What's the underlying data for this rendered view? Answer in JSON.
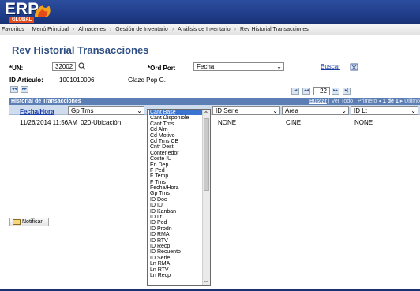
{
  "brand": {
    "logo_text": "ERP",
    "logo_sub": "GLOBAL"
  },
  "menu": {
    "items": [
      "Favoritos",
      "Menú Principal",
      "Almacenes",
      "Gestión de Inventario",
      "Análisis de Inventario",
      "Rev Historial Transacciones"
    ]
  },
  "page": {
    "title": "Rev Historial Transacciones"
  },
  "filters": {
    "un_label": "*UN:",
    "un_value": "32002",
    "ord_label": "*Ord Por:",
    "ord_value": "Fecha",
    "search_label": "Buscar",
    "article_label": "ID Artículo:",
    "article_id": "1001010006",
    "article_desc": "Glaze Pop G."
  },
  "pager_top": {
    "page_value": "22"
  },
  "grid": {
    "title": "Historial de Transacciones",
    "tools": {
      "find": "Buscar",
      "view_all": "Ver Todo",
      "first": "Primero",
      "range": "1 de 1",
      "last": "Último"
    },
    "col_date": "Fecha/Hora",
    "col_select_1": "Gp Trns",
    "col_select_2": "ID Serie",
    "col_select_3": "Area",
    "col_select_4": "ID Lt",
    "row": {
      "date": "11/26/2014 11:56AM",
      "location": "020-Ubicación",
      "serie": "NONE",
      "area": "CINE",
      "lot": "NONE"
    }
  },
  "dropdown": {
    "selected": "Cant Base",
    "options": [
      "Cant Base",
      "Cant Disponible",
      "Cant Trns",
      "Cd Alm",
      "Cd Motivo",
      "Cd Trns CB",
      "Cntr Dest",
      "Contenedor",
      "Coste IU",
      "En Dep",
      "F Ped",
      "F Temp",
      "F Trns",
      "Fecha/Hora",
      "Gp Trns",
      "ID Doc",
      "ID IU",
      "ID Kanban",
      "ID Lt",
      "ID Ped",
      "ID Prodn",
      "ID RMA",
      "ID RTV",
      "ID Recp",
      "ID Recuento",
      "ID Serie",
      "Ln RMA",
      "Ln RTV",
      "Ln Recp"
    ]
  },
  "actions": {
    "notify": "Notificar"
  },
  "colors": {
    "banner": "#1e3b86",
    "title": "#2f4f83",
    "grid_header": "#5b7fb5",
    "selection": "#3a73d0"
  }
}
